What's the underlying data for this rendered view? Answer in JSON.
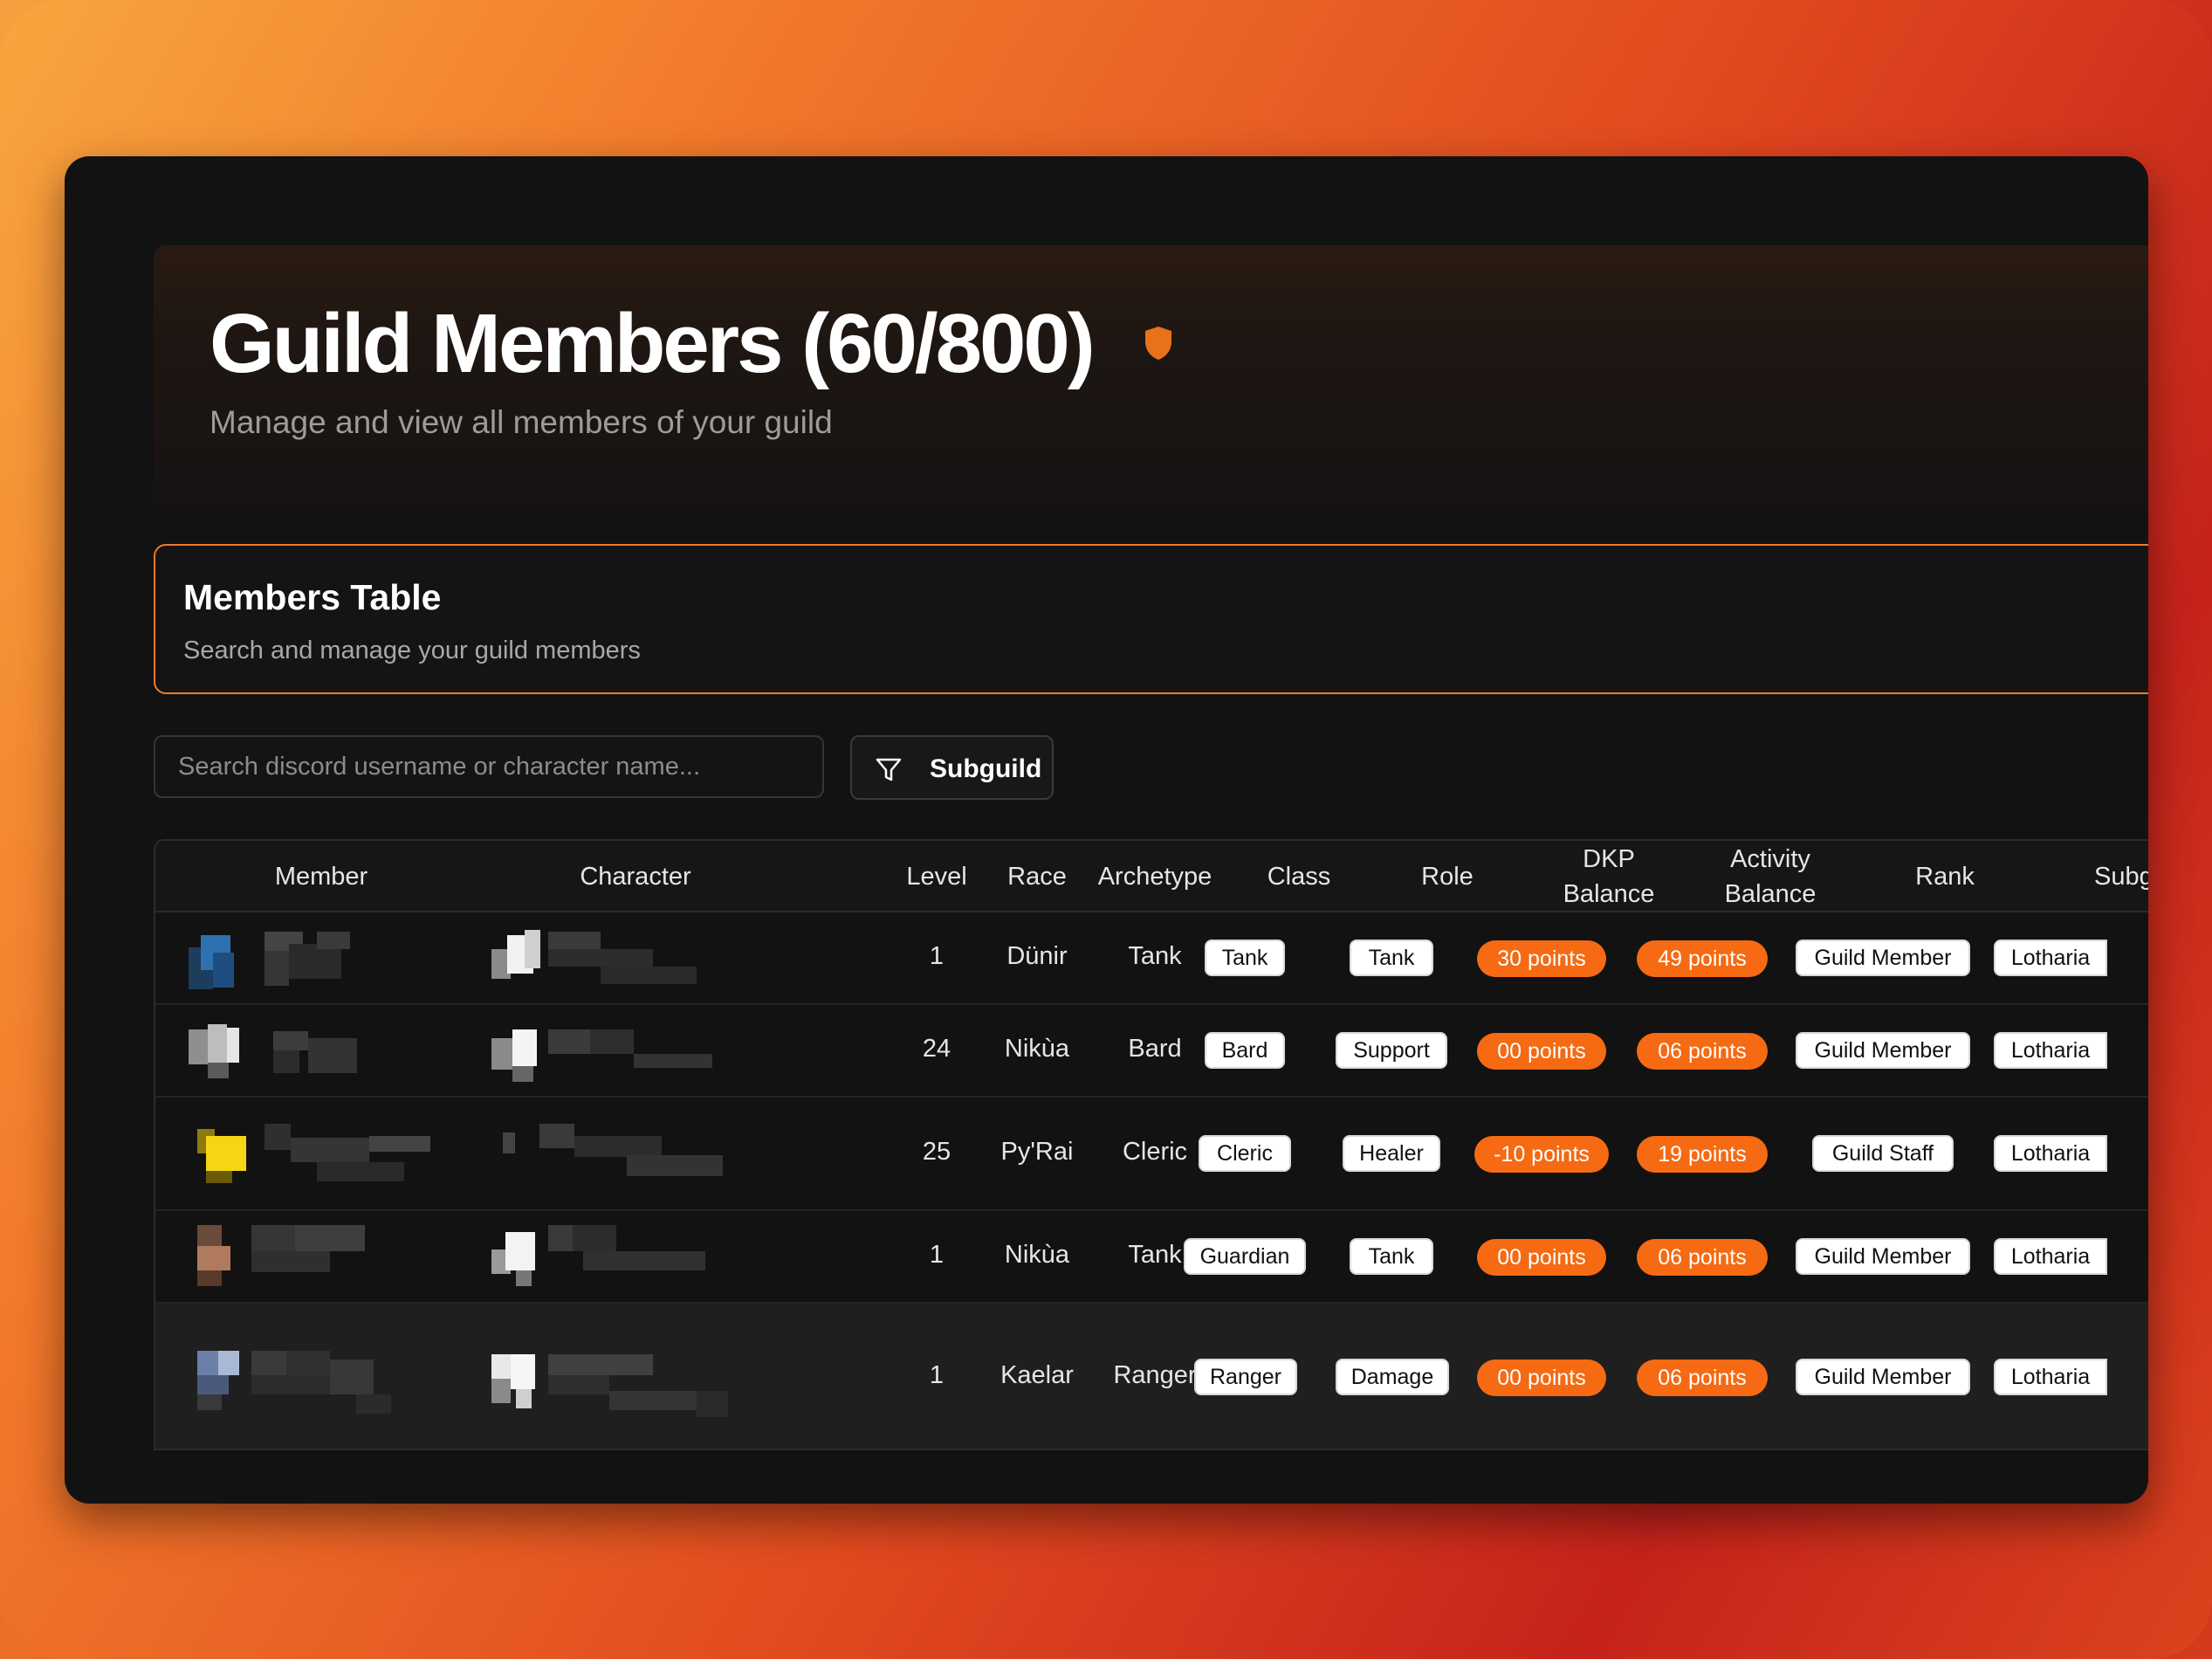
{
  "header": {
    "title": "Guild Members (60/800)",
    "subtitle": "Manage and view all members of your guild",
    "accent": "#e8711c"
  },
  "members_card": {
    "title": "Members Table",
    "subtitle": "Search and manage your guild members"
  },
  "search": {
    "placeholder": "Search discord username or character name..."
  },
  "filter": {
    "label": "Subguild"
  },
  "table": {
    "columns": {
      "member": "Member",
      "character": "Character",
      "level": "Level",
      "race": "Race",
      "archetype": "Archetype",
      "class": "Class",
      "role": "Role",
      "dkp_line1": "DKP",
      "dkp_line2": "Balance",
      "activity_line1": "Activity",
      "activity_line2": "Balance",
      "rank": "Rank",
      "subguild": "Subgu"
    },
    "rows": [
      {
        "level": "1",
        "race": "Dünir",
        "archetype": "Tank",
        "class": "Tank",
        "role": "Tank",
        "dkp": "30 points",
        "activity": "49 points",
        "rank": "Guild Member",
        "subguild": "Lotharia"
      },
      {
        "level": "24",
        "race": "Nikùa",
        "archetype": "Bard",
        "class": "Bard",
        "role": "Support",
        "dkp": "00 points",
        "activity": "06 points",
        "rank": "Guild Member",
        "subguild": "Lotharia"
      },
      {
        "level": "25",
        "race": "Py'Rai",
        "archetype": "Cleric",
        "class": "Cleric",
        "role": "Healer",
        "dkp": "-10 points",
        "activity": "19 points",
        "rank": "Guild Staff",
        "subguild": "Lotharia"
      },
      {
        "level": "1",
        "race": "Nikùa",
        "archetype": "Tank",
        "class": "Guardian",
        "role": "Tank",
        "dkp": "00 points",
        "activity": "06 points",
        "rank": "Guild Member",
        "subguild": "Lotharia"
      },
      {
        "level": "1",
        "race": "Kaelar",
        "archetype": "Ranger",
        "class": "Ranger",
        "role": "Damage",
        "dkp": "00 points",
        "activity": "06 points",
        "rank": "Guild Member",
        "subguild": "Lotharia"
      }
    ]
  }
}
